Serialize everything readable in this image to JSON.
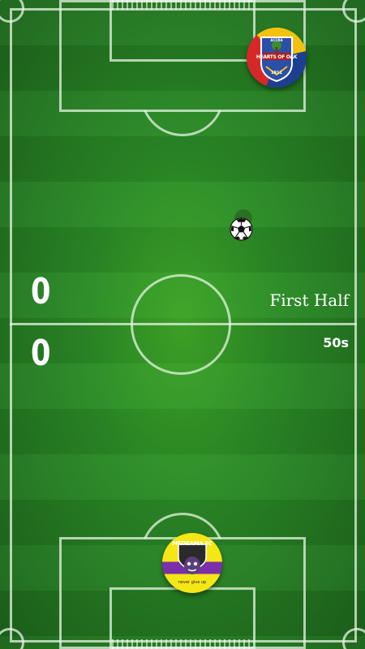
{
  "scoreboard": {
    "top_score": "0",
    "bottom_score": "0",
    "half_label": "First Half",
    "timer": "50s"
  },
  "top_team": {
    "name": "HEARTS OF OAK",
    "subtitle": "ACCRA",
    "year": "1911",
    "colors": [
      "#d62828",
      "#f4c20d",
      "#1d3f8f"
    ]
  },
  "bottom_team": {
    "name": "MEDEAMA SC",
    "motto": "never give up",
    "colors": [
      "#f5e616",
      "#7b2fa8",
      "#2a2a2a"
    ]
  },
  "ball": {
    "icon": "soccer-ball-icon"
  }
}
